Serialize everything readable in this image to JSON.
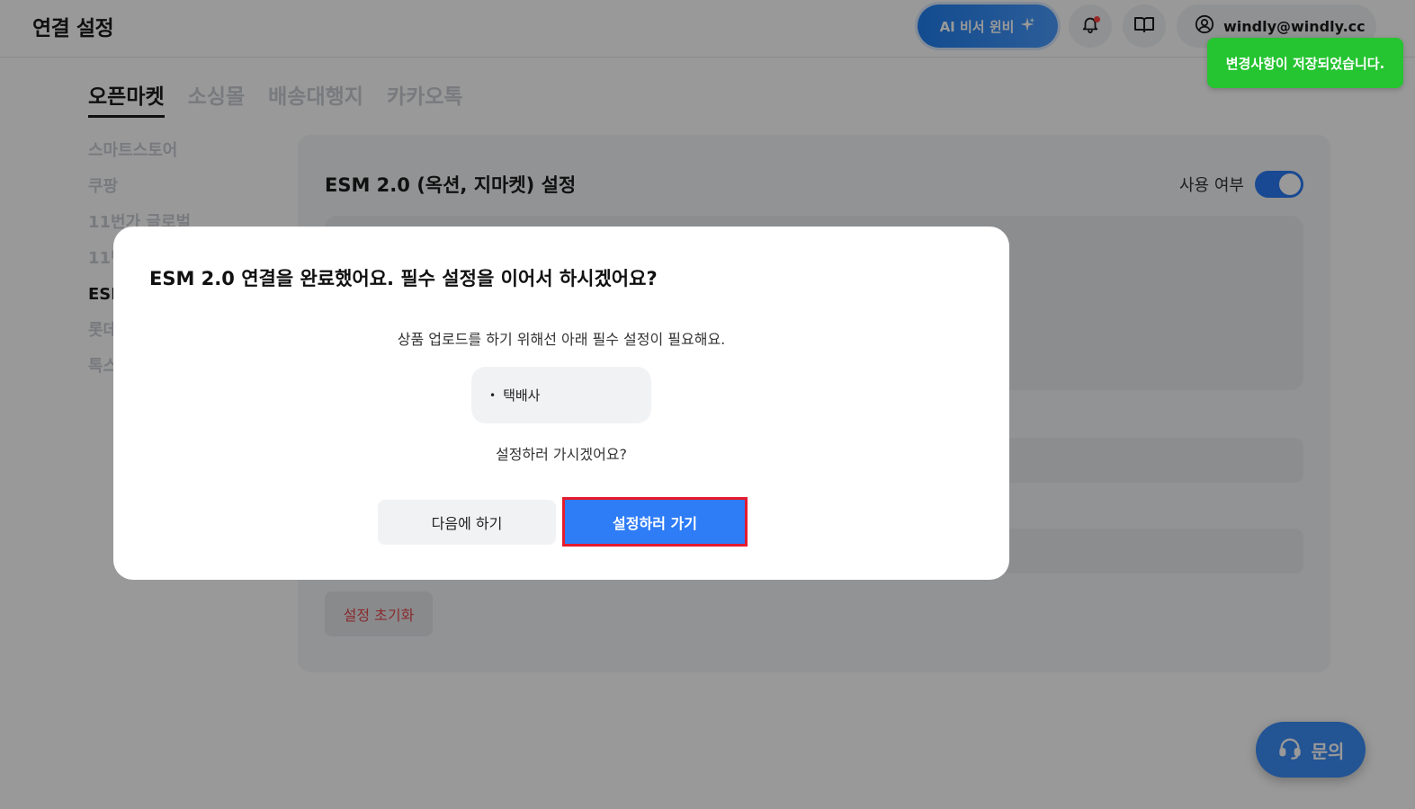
{
  "header": {
    "title": "연결 설정",
    "ai_button_label": "AI 비서 윈비",
    "ai_icon": "sparkle-icon",
    "user_email": "windly@windly.cc"
  },
  "toast": {
    "message": "변경사항이 저장되었습니다."
  },
  "tabs": [
    {
      "label": "오픈마켓",
      "active": true
    },
    {
      "label": "소싱몰",
      "active": false
    },
    {
      "label": "배송대행지",
      "active": false
    },
    {
      "label": "카카오톡",
      "active": false
    }
  ],
  "side_nav": [
    {
      "label": "스마트스토어",
      "active": false
    },
    {
      "label": "쿠팡",
      "active": false
    },
    {
      "label": "11번가 글로벌",
      "active": false
    },
    {
      "label": "11번",
      "active": false
    },
    {
      "label": "ESM",
      "active": true
    },
    {
      "label": "롯데",
      "active": false
    },
    {
      "label": "톡스",
      "active": false
    }
  ],
  "card": {
    "title": "ESM 2.0 (옥션, 지마켓) 설정",
    "use_label": "사용 여부",
    "use_enabled": true,
    "reset_button": "설정 초기화"
  },
  "modal": {
    "title": "ESM 2.0 연결을 완료했어요. 필수 설정을 이어서 하시겠어요?",
    "description": "상품 업로드를 하기 위해선 아래 필수 설정이 필요해요.",
    "required_items": [
      "택배사"
    ],
    "question": "설정하러 가시겠어요?",
    "later_button": "다음에 하기",
    "go_button": "설정하러 가기"
  },
  "fab": {
    "label": "문의"
  },
  "colors": {
    "primary": "#2e7cf6",
    "toast_green": "#25c431",
    "highlight_red": "#e41b2e",
    "reset_red": "#e5484d"
  }
}
